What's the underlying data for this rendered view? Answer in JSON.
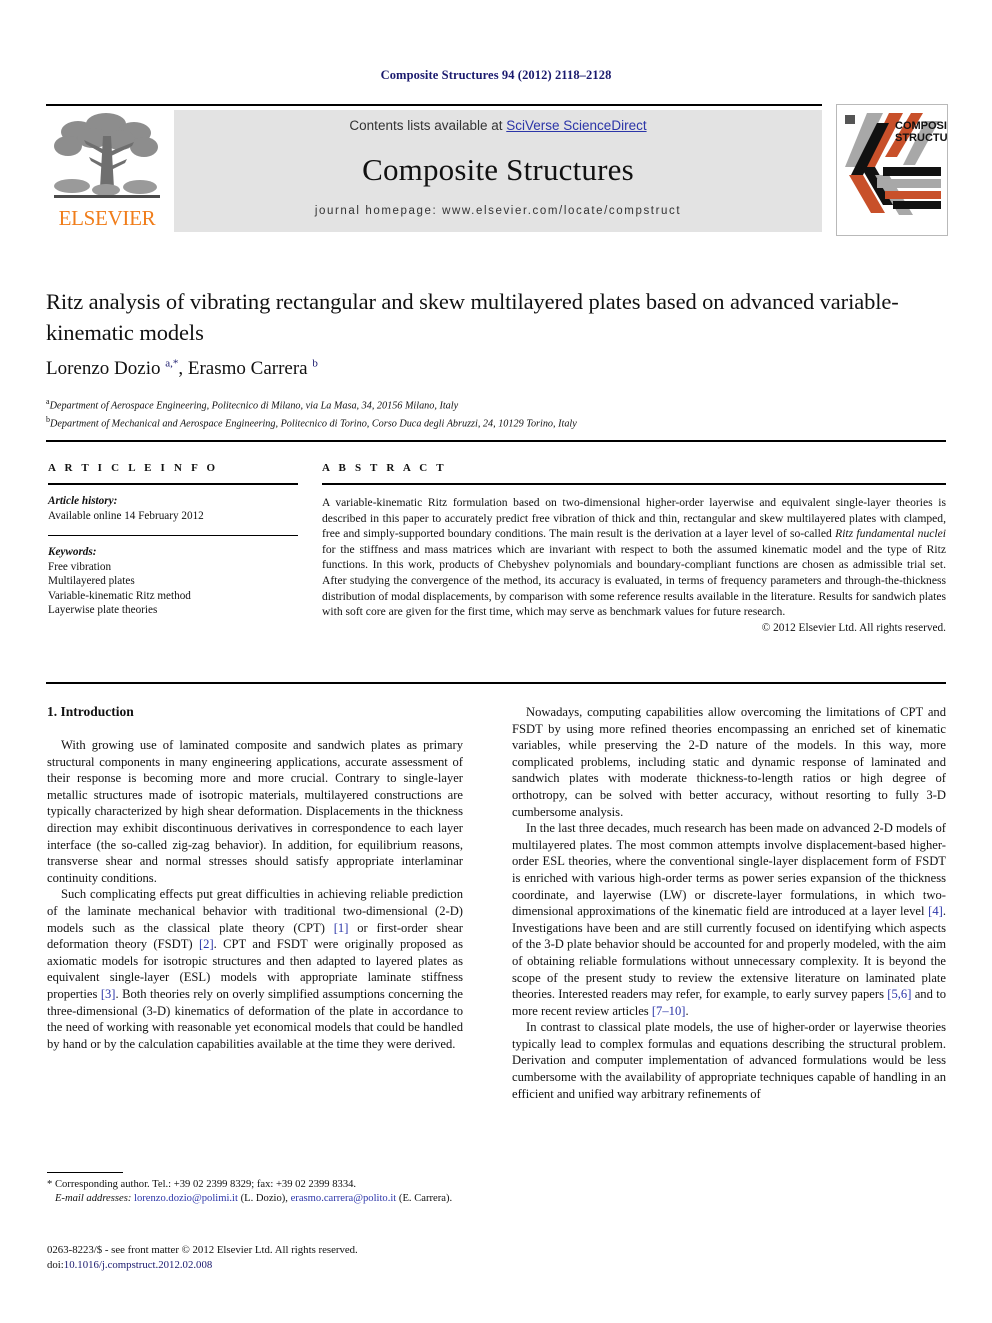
{
  "running_head": "Composite Structures 94 (2012) 2118–2128",
  "masthead": {
    "contents_prefix": "Contents lists available at ",
    "contents_link": "SciVerse ScienceDirect",
    "journal_title": "Composite Structures",
    "homepage": "journal homepage: www.elsevier.com/locate/compstruct",
    "publisher_name": "ELSEVIER",
    "publisher_logo_icon": "elsevier-tree-logo",
    "cover_thumb_icon": "journal-cover-thumbnail",
    "cover_title_line1": "COMPOSITE",
    "cover_title_line2": "STRUCTURES"
  },
  "article": {
    "title": "Ritz analysis of vibrating rectangular and skew multilayered plates based on advanced variable-kinematic models",
    "authors_html": "Lorenzo Dozio <sup>a,*</sup>, Erasmo Carrera <sup>b</sup>",
    "affiliation_a": "Department of Aerospace Engineering, Politecnico di Milano, via La Masa, 34, 20156 Milano, Italy",
    "affiliation_b": "Department of Mechanical and Aerospace Engineering, Politecnico di Torino, Corso Duca degli Abruzzi, 24, 10129 Torino, Italy"
  },
  "article_info": {
    "heading": "A R T I C L E   I N F O",
    "history_label": "Article history:",
    "history_value": "Available online 14 February 2012",
    "keywords_label": "Keywords:",
    "keywords": [
      "Free vibration",
      "Multilayered plates",
      "Variable-kinematic Ritz method",
      "Layerwise plate theories"
    ]
  },
  "abstract": {
    "heading": "A B S T R A C T",
    "text_part1": "A variable-kinematic Ritz formulation based on two-dimensional higher-order layerwise and equivalent single-layer theories is described in this paper to accurately predict free vibration of thick and thin, rectangular and skew multilayered plates with clamped, free and simply-supported boundary conditions. The main result is the derivation at a layer level of so-called ",
    "text_italic": "Ritz fundamental nuclei",
    "text_part2": " for the stiffness and mass matrices which are invariant with respect to both the assumed kinematic model and the type of Ritz functions. In this work, products of Chebyshev polynomials and boundary-compliant functions are chosen as admissible trial set. After studying the convergence of the method, its accuracy is evaluated, in terms of frequency parameters and through-the-thickness distribution of modal displacements, by comparison with some reference results available in the literature. Results for sandwich plates with soft core are given for the first time, which may serve as benchmark values for future research.",
    "copyright": "© 2012 Elsevier Ltd. All rights reserved."
  },
  "body": {
    "section_heading": "1. Introduction",
    "left_paragraphs": [
      "With growing use of laminated composite and sandwich plates as primary structural components in many engineering applications, accurate assessment of their response is becoming more and more crucial. Contrary to single-layer metallic structures made of isotropic materials, multilayered constructions are typically characterized by high shear deformation. Displacements in the thickness direction may exhibit discontinuous derivatives in correspondence to each layer interface (the so-called zig-zag behavior). In addition, for equilibrium reasons, transverse shear and normal stresses should satisfy appropriate interlaminar continuity conditions."
    ],
    "left_par2_a": "Such complicating effects put great difficulties in achieving reliable prediction of the laminate mechanical behavior with traditional two-dimensional (2-D) models such as the classical plate theory (CPT) ",
    "left_par2_ref1": "[1]",
    "left_par2_b": " or first-order shear deformation theory (FSDT) ",
    "left_par2_ref2": "[2]",
    "left_par2_c": ". CPT and FSDT were originally proposed as axiomatic models for isotropic structures and then adapted to layered plates as equivalent single-layer (ESL) models with appropriate laminate stiffness properties ",
    "left_par2_ref3": "[3]",
    "left_par2_d": ". Both theories rely on overly simplified assumptions concerning the three-dimensional (3-D) kinematics of deformation of the plate in accordance to the need of working with reasonable yet economical models that could be handled by hand or by the calculation capabilities available at the time they were derived.",
    "right_par1": "Nowadays, computing capabilities allow overcoming the limitations of CPT and FSDT by using more refined theories encompassing an enriched set of kinematic variables, while preserving the 2-D nature of the models. In this way, more complicated problems, including static and dynamic response of laminated and sandwich plates with moderate thickness-to-length ratios or high degree of orthotropy, can be solved with better accuracy, without resorting to fully 3-D cumbersome analysis.",
    "right_par2_a": "In the last three decades, much research has been made on advanced 2-D models of multilayered plates. The most common attempts involve displacement-based higher-order ESL theories, where the conventional single-layer displacement form of FSDT is enriched with various high-order terms as power series expansion of the thickness coordinate, and layerwise (LW) or discrete-layer formulations, in which two-dimensional approximations of the kinematic field are introduced at a layer level ",
    "right_par2_ref4": "[4]",
    "right_par2_b": ". Investigations have been and are still currently focused on identifying which aspects of the 3-D plate behavior should be accounted for and properly modeled, with the aim of obtaining reliable formulations without unnecessary complexity. It is beyond the scope of the present study to review the extensive literature on laminated plate theories. Interested readers may refer, for example, to early survey papers ",
    "right_par2_ref56": "[5,6]",
    "right_par2_c": " and to more recent review articles ",
    "right_par2_ref710": "[7–10]",
    "right_par2_d": ".",
    "right_par3": "In contrast to classical plate models, the use of higher-order or layerwise theories typically lead to complex formulas and equations describing the structural problem. Derivation and computer implementation of advanced formulations would be less cumbersome with the availability of appropriate techniques capable of handling in an efficient and unified way arbitrary refinements of"
  },
  "footnotes": {
    "corresponding": "* Corresponding author. Tel.: +39 02 2399 8329; fax: +39 02 2399 8334.",
    "email_label": "E-mail addresses:",
    "email_1": "lorenzo.dozio@polimi.it",
    "email_1_owner": "(L. Dozio),",
    "email_2": "erasmo.carrera@polito.it",
    "email_2_owner": "(E. Carrera)."
  },
  "footer": {
    "issn_line": "0263-8223/$ - see front matter © 2012 Elsevier Ltd. All rights reserved.",
    "doi_label": "doi:",
    "doi_value": "10.1016/j.compstruct.2012.02.008"
  },
  "colors": {
    "link": "#2b35a8",
    "running_head": "#1a1a6e",
    "elsevier_orange": "#f07d1a",
    "band_grey": "#e3e3e3"
  }
}
